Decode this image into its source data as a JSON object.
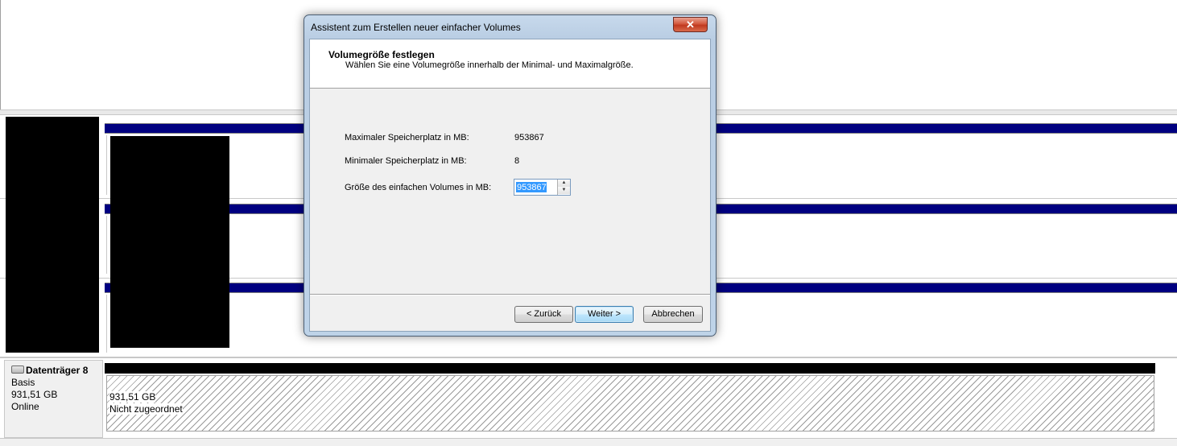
{
  "dialog": {
    "title": "Assistent zum Erstellen neuer einfacher Volumes",
    "close_symbol": "✕",
    "header_title": "Volumegröße festlegen",
    "header_subtitle": "Wählen Sie eine Volumegröße innerhalb der Minimal- und Maximalgröße.",
    "max_label": "Maximaler Speicherplatz in MB:",
    "max_value": "953867",
    "min_label": "Minimaler Speicherplatz in MB:",
    "min_value": "8",
    "size_label": "Größe des einfachen Volumes in MB:",
    "size_value": "953867",
    "back_label": "< Zurück",
    "next_label": "Weiter >",
    "cancel_label": "Abbrechen"
  },
  "disk8": {
    "title": "Datenträger 8",
    "type": "Basis",
    "size": "931,51 GB",
    "status": "Online",
    "partition_size": "931,51 GB",
    "partition_status": "Nicht zugeordnet"
  },
  "colors": {
    "primary_partition_bar": "#000080",
    "unallocated_bar": "#000000",
    "selection": "#3399ff"
  },
  "icons": {
    "disk": "disk-icon",
    "close": "close-icon",
    "spin_up": "spin-up-icon",
    "spin_down": "spin-down-icon"
  }
}
